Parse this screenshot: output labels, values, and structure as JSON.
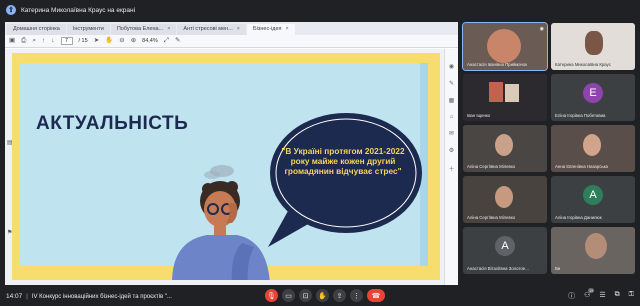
{
  "presenter": {
    "label": "Катерина Миколаївна Краус на екрані",
    "icon": "screen-share-icon"
  },
  "browser": {
    "tabs": [
      {
        "label": "Домашня сторінка"
      },
      {
        "label": "Інструменти"
      },
      {
        "label": "Побутова Елена..."
      },
      {
        "label": "Анті стресові мен..."
      },
      {
        "label": "Бізнес-ідея"
      }
    ],
    "active_tab": 4,
    "page_current": "7",
    "page_total": "/ 15",
    "zoom": "84,4%"
  },
  "slide": {
    "title": "АКТУАЛЬНІСТЬ",
    "quote": "\"В Україні протягом 2021-2022 року майже кожен другий громадянин відчуває стрес\"",
    "colors": {
      "background": "#bfe3ef",
      "frame": "#f7dc6f",
      "bubble": "#1d2a4f",
      "quote_text": "#f4d35e"
    }
  },
  "participants": [
    {
      "name": "Анастасія Іванівна Приймачок",
      "kind": "photo",
      "speaking": true
    },
    {
      "name": "Катерина Миколаївна Краус",
      "kind": "photo",
      "speaking": false
    },
    {
      "name": "Іван Іщенко",
      "kind": "photo",
      "speaking": false
    },
    {
      "name": "Еліна Ігорівна Побетавиа",
      "kind": "letter",
      "letter": "E",
      "color": "#8e44ad"
    },
    {
      "name": "Аліна Сергіївна Мілевко",
      "kind": "photo",
      "speaking": false
    },
    {
      "name": "Анна Євгенівна Назарська",
      "kind": "photo",
      "speaking": false
    },
    {
      "name": "Аліна Сергіївна Мілевко",
      "kind": "photo",
      "speaking": false
    },
    {
      "name": "Аліна Ігорівна Данилюк",
      "kind": "letter",
      "letter": "A",
      "color": "#2e7d5b"
    },
    {
      "name": "Анастасія Віталіївна Золотое...",
      "kind": "letter",
      "letter": "A",
      "color": "#5f6368"
    },
    {
      "name": "Ви",
      "kind": "photo",
      "speaking": false
    }
  ],
  "bottom": {
    "time": "14:07",
    "separator": "|",
    "meeting_title": "IV Конкурс інноваційних бізнес-ідей та проєктів \"...",
    "participants_count": "19"
  }
}
